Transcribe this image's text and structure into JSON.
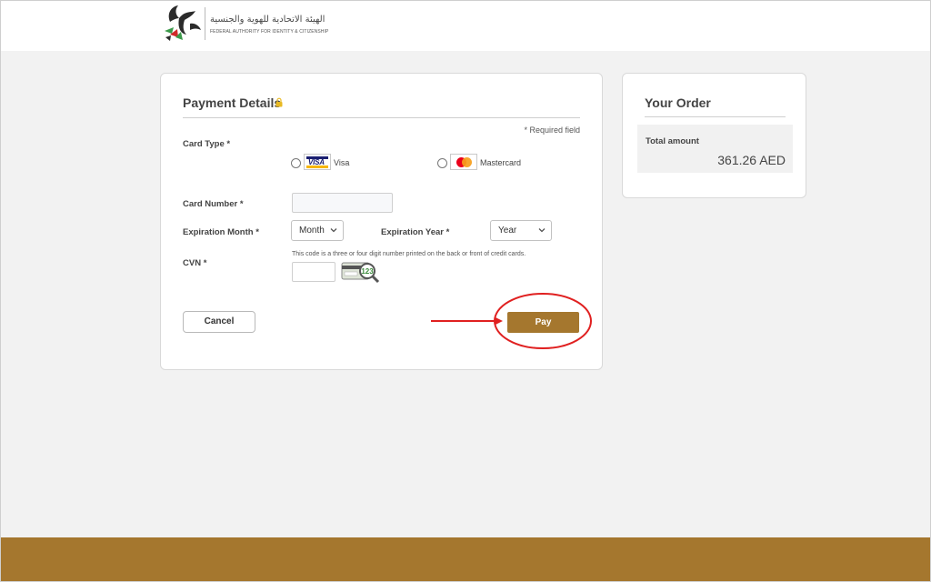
{
  "header": {
    "logo_arabic": "الهيئة الاتحادية للهوية والجنسية",
    "logo_english": "FEDERAL AUTHORITY FOR IDENTITY & CITIZENSHIP"
  },
  "payment": {
    "title": "Payment Details",
    "required_note": "* Required field",
    "card_type_label": "Card Type *",
    "options": [
      {
        "label": "Visa",
        "logo_text": "VISA",
        "icon": "visa-logo-icon",
        "selected": false
      },
      {
        "label": "Mastercard",
        "icon": "mastercard-logo-icon",
        "selected": false
      }
    ],
    "card_number_label": "Card Number *",
    "card_number_value": "",
    "expiration_month_label": "Expiration Month *",
    "expiration_month_value": "Month",
    "expiration_year_label": "Expiration Year *",
    "expiration_year_value": "Year",
    "cvn_label": "CVN *",
    "cvn_help": "This code is a three or four digit number printed on the back or front of credit cards.",
    "cvn_value": "",
    "cvn_illustration_text": "123",
    "cancel_label": "Cancel",
    "pay_label": "Pay"
  },
  "order": {
    "title": "Your Order",
    "total_label": "Total amount",
    "total_value": "361.26 AED"
  },
  "colors": {
    "accent": "#a5772e",
    "annotation": "#e02020",
    "lock": "#e8b923"
  }
}
